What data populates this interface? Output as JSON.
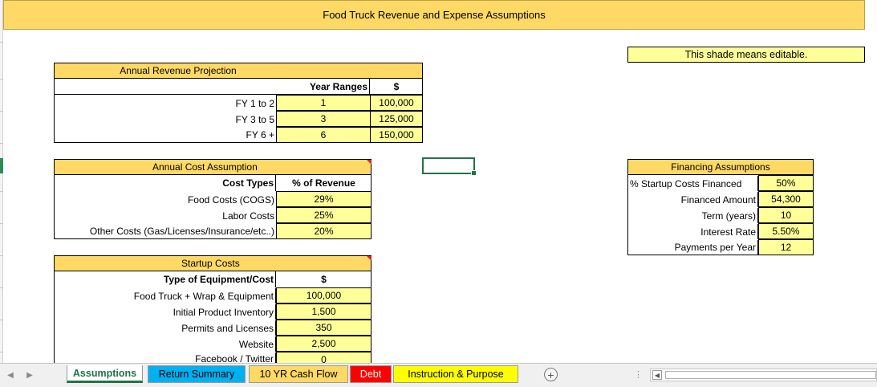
{
  "banner": {
    "title": "Food Truck Revenue and Expense Assumptions"
  },
  "note": {
    "text": "This shade means editable."
  },
  "revenue": {
    "title": "Annual Revenue Projection",
    "col_ranges": "Year Ranges",
    "col_amount": "$",
    "rows": [
      {
        "label": "FY 1 to 2",
        "range": "1",
        "amount": "100,000"
      },
      {
        "label": "FY 3 to 5",
        "range": "3",
        "amount": "125,000"
      },
      {
        "label": "FY 6 +",
        "range": "6",
        "amount": "150,000"
      }
    ]
  },
  "cost": {
    "title": "Annual Cost Assumption",
    "col_type": "Cost Types",
    "col_pct": "% of Revenue",
    "rows": [
      {
        "label": "Food Costs (COGS)",
        "pct": "29%"
      },
      {
        "label": "Labor Costs",
        "pct": "25%"
      },
      {
        "label": "Other Costs (Gas/Licenses/Insurance/etc..)",
        "pct": "20%"
      }
    ]
  },
  "startup": {
    "title": "Startup Costs",
    "col_type": "Type of Equipment/Cost",
    "col_amount": "$",
    "rows": [
      {
        "label": "Food Truck + Wrap & Equipment",
        "amount": "100,000"
      },
      {
        "label": "Initial Product Inventory",
        "amount": "1,500"
      },
      {
        "label": "Permits and Licenses",
        "amount": "350"
      },
      {
        "label": "Website",
        "amount": "2,500"
      },
      {
        "label": "Facebook / Twitter",
        "amount": "0"
      }
    ]
  },
  "financing": {
    "title": "Financing Assumptions",
    "rows": [
      {
        "label": "% Startup Costs Financed",
        "value": "50%"
      },
      {
        "label": "Financed Amount",
        "value": "54,300"
      },
      {
        "label": "Term (years)",
        "value": "10"
      },
      {
        "label": "Interest Rate",
        "value": "5.50%"
      },
      {
        "label": "Payments per Year",
        "value": "12"
      }
    ]
  },
  "tabs": [
    {
      "label": "Assumptions",
      "color": "#ffffff"
    },
    {
      "label": "Return Summary",
      "color": "#00b0f0"
    },
    {
      "label": "10 YR Cash Flow",
      "color": "#ffd966"
    },
    {
      "label": "Debt",
      "color": "#ff0000"
    },
    {
      "label": "Instruction & Purpose",
      "color": "#ffff00"
    }
  ],
  "tabbar": {
    "add_icon": "plus-circle-icon",
    "add_symbol": "+",
    "more": "⋮",
    "prev": "◀",
    "next": "▶",
    "scroll_left": "◀"
  }
}
